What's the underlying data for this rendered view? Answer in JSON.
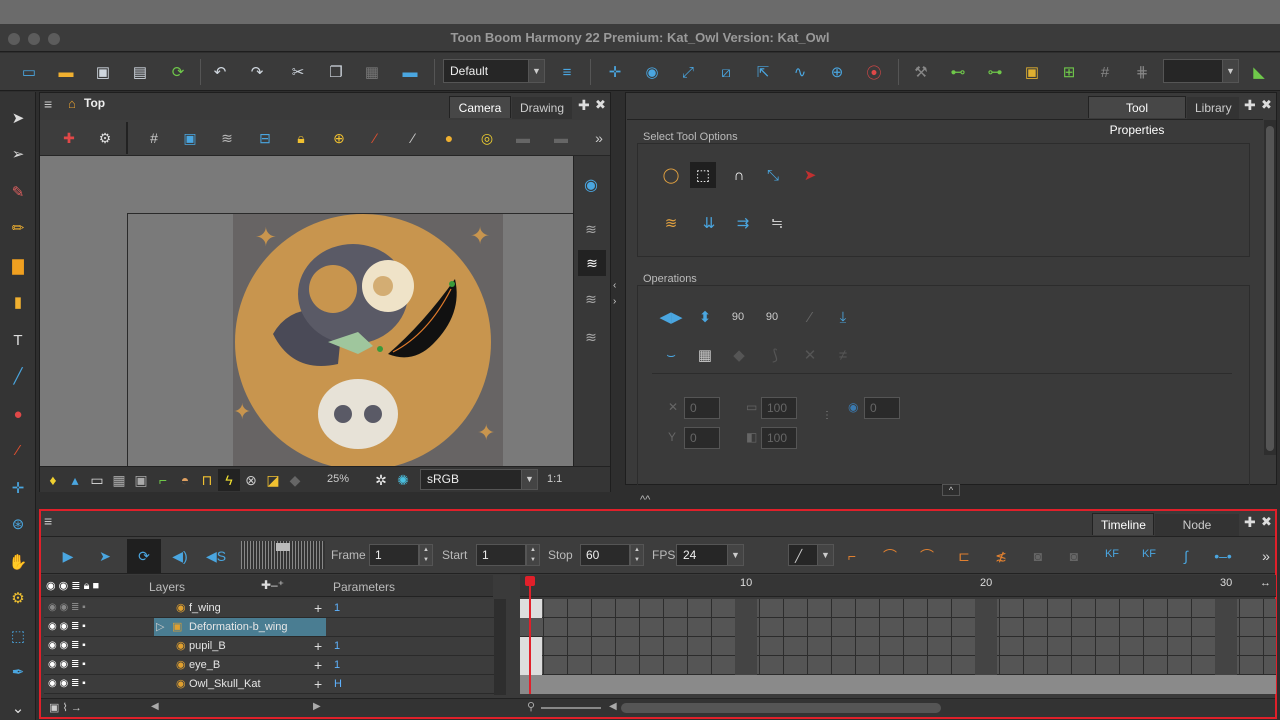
{
  "window": {
    "title": "Toon Boom Harmony 22 Premium: Kat_Owl Version: Kat_Owl"
  },
  "toolbar": {
    "workspace": "Default"
  },
  "camera_view": {
    "breadcrumb": "Top",
    "tabs": [
      "Camera",
      "Drawing"
    ],
    "zoom": "25%",
    "color_space": "sRGB",
    "ratio": "1:1"
  },
  "tool_properties": {
    "tabs": [
      "Tool Properties",
      "Library"
    ],
    "section_select": "Select Tool Options",
    "section_ops": "Operations",
    "fields": {
      "x": "0",
      "y": "0",
      "w": "100",
      "h": "100",
      "angle": "0"
    }
  },
  "timeline": {
    "tabs": [
      "Timeline",
      "Node Library"
    ],
    "frame_label": "Frame",
    "frame": "1",
    "start_label": "Start",
    "start": "1",
    "stop_label": "Stop",
    "stop": "60",
    "fps_label": "FPS",
    "fps": "24",
    "layers_header": "Layers",
    "params_header": "Parameters",
    "ruler": [
      "10",
      "20",
      "30"
    ],
    "layers": [
      {
        "name": "f_wing",
        "param": "1"
      },
      {
        "name": "Deformation-b_wing",
        "param": ""
      },
      {
        "name": "pupil_B",
        "param": "1"
      },
      {
        "name": "eye_B",
        "param": "1"
      },
      {
        "name": "Owl_Skull_Kat",
        "param": "H"
      }
    ]
  },
  "colors": {
    "accent_red": "#e0202a",
    "selection": "#4a7d92",
    "orange_moon": "#c8954e"
  }
}
